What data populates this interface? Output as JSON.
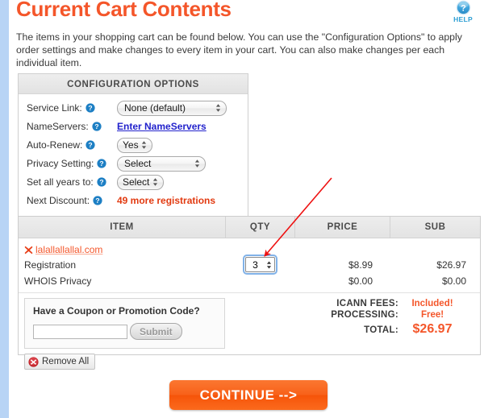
{
  "header": {
    "title": "Current Cart Contents",
    "help_label": "HELP",
    "help_icon": "question-mark-circle-icon",
    "intro": "The items in your shopping cart can be found below. You can use the \"Configuration Options\" to apply order settings and make changes to every item in your cart. You can also make changes per each individual item."
  },
  "config": {
    "title": "CONFIGURATION OPTIONS",
    "rows": [
      {
        "label": "Service Link:",
        "control": "select",
        "value": "None (default)"
      },
      {
        "label": "NameServers:",
        "control": "link",
        "value": "Enter NameServers"
      },
      {
        "label": "Auto-Renew:",
        "control": "select",
        "value": "Yes"
      },
      {
        "label": "Privacy Setting:",
        "control": "select",
        "value": "Select"
      },
      {
        "label": "Set all years to:",
        "control": "select",
        "value": "Select"
      },
      {
        "label": "Next Discount:",
        "control": "text",
        "value": "49 more registrations"
      }
    ]
  },
  "cart": {
    "columns": [
      "ITEM",
      "QTY",
      "PRICE",
      "SUB"
    ],
    "domain": "lalallallallal.com",
    "lines": [
      {
        "item": "Registration",
        "qty": "3",
        "price": "$8.99",
        "sub": "$26.97"
      },
      {
        "item": "WHOIS Privacy",
        "qty": "",
        "price": "$0.00",
        "sub": "$0.00"
      }
    ]
  },
  "coupon": {
    "title": "Have a Coupon or Promotion Code?",
    "input_value": "",
    "input_placeholder": "",
    "submit_label": "Submit"
  },
  "totals": [
    {
      "label": "ICANN FEES:",
      "value": "Included!"
    },
    {
      "label": "PROCESSING:",
      "value": "Free!"
    },
    {
      "label": "TOTAL:",
      "value": "$26.97"
    }
  ],
  "actions": {
    "remove_all_label": "Remove All",
    "continue_label": "CONTINUE -->"
  },
  "colors": {
    "accent_orange": "#f4562a",
    "link_blue": "#2222cc",
    "help_blue": "#2e9fd4",
    "annotation_red": "#ee1111",
    "gutter_blue": "#b8d4f5"
  }
}
